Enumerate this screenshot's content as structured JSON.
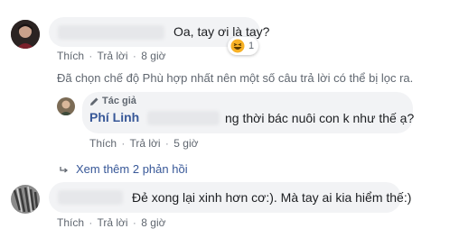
{
  "comments": [
    {
      "text": "Oa, tay ơi là tay?",
      "reaction_count": "1",
      "reaction_icon": "haha-emoji-icon",
      "actions": {
        "like": "Thích",
        "reply": "Trả lời",
        "time": "8 giờ"
      }
    },
    {
      "text": "Đẻ xong lại xinh hơn cơ:). Mà tay ai kia hiểm thế:)",
      "actions": {
        "like": "Thích",
        "reply": "Trả lời",
        "time": "8 giờ"
      }
    }
  ],
  "filter_notice": "Đã chọn chế độ Phù hợp nhất nên một số câu trả lời có thể bị lọc ra.",
  "reply": {
    "author_badge": "Tác giả",
    "author_name": "Phí Linh",
    "text": "ng thời bác nuôi con k như thế ạ?",
    "actions": {
      "like": "Thích",
      "reply": "Trả lời",
      "time": "5 giờ"
    }
  },
  "more_replies": "Xem thêm 2 phản hồi",
  "separator": "·",
  "colors": {
    "link": "#385898",
    "bubble": "#f2f3f5",
    "meta": "#606770"
  }
}
